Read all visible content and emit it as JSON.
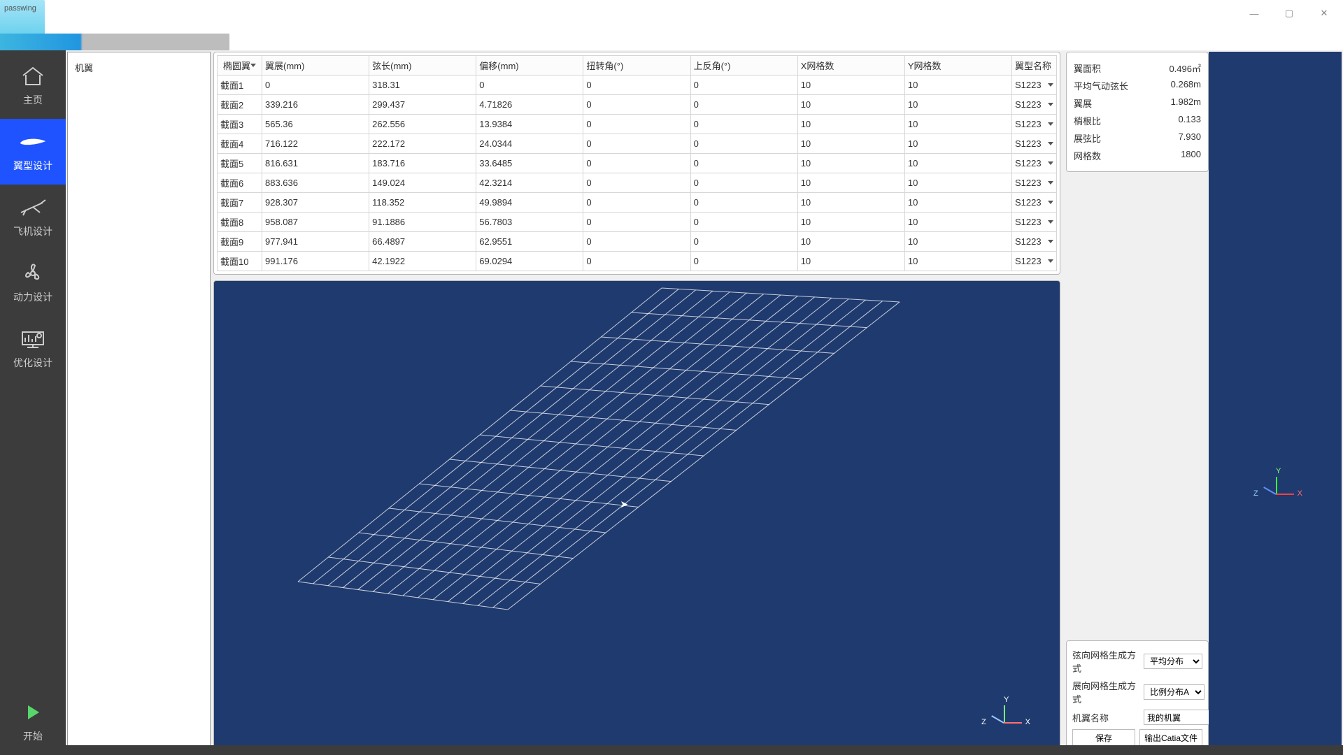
{
  "window": {
    "title": "passwing"
  },
  "nav": {
    "items": [
      {
        "id": "home",
        "label": "主页"
      },
      {
        "id": "wing",
        "label": "翼型设计"
      },
      {
        "id": "plane",
        "label": "飞机设计"
      },
      {
        "id": "power",
        "label": "动力设计"
      },
      {
        "id": "optimize",
        "label": "优化设计"
      }
    ],
    "start_label": "开始",
    "active": "wing"
  },
  "tree": {
    "root": "机翼"
  },
  "table": {
    "shape_selector": "椭圆翼",
    "headers": [
      "翼展(mm)",
      "弦长(mm)",
      "偏移(mm)",
      "扭转角(°)",
      "上反角(°)",
      "X网格数",
      "Y网格数",
      "翼型名称"
    ],
    "rows": [
      {
        "label": "截面1",
        "span": "0",
        "chord": "318.31",
        "offset": "0",
        "twist": "0",
        "dihedral": "0",
        "xg": "10",
        "yg": "10",
        "airfoil": "S1223"
      },
      {
        "label": "截面2",
        "span": "339.216",
        "chord": "299.437",
        "offset": "4.71826",
        "twist": "0",
        "dihedral": "0",
        "xg": "10",
        "yg": "10",
        "airfoil": "S1223"
      },
      {
        "label": "截面3",
        "span": "565.36",
        "chord": "262.556",
        "offset": "13.9384",
        "twist": "0",
        "dihedral": "0",
        "xg": "10",
        "yg": "10",
        "airfoil": "S1223"
      },
      {
        "label": "截面4",
        "span": "716.122",
        "chord": "222.172",
        "offset": "24.0344",
        "twist": "0",
        "dihedral": "0",
        "xg": "10",
        "yg": "10",
        "airfoil": "S1223"
      },
      {
        "label": "截面5",
        "span": "816.631",
        "chord": "183.716",
        "offset": "33.6485",
        "twist": "0",
        "dihedral": "0",
        "xg": "10",
        "yg": "10",
        "airfoil": "S1223"
      },
      {
        "label": "截面6",
        "span": "883.636",
        "chord": "149.024",
        "offset": "42.3214",
        "twist": "0",
        "dihedral": "0",
        "xg": "10",
        "yg": "10",
        "airfoil": "S1223"
      },
      {
        "label": "截面7",
        "span": "928.307",
        "chord": "118.352",
        "offset": "49.9894",
        "twist": "0",
        "dihedral": "0",
        "xg": "10",
        "yg": "10",
        "airfoil": "S1223"
      },
      {
        "label": "截面8",
        "span": "958.087",
        "chord": "91.1886",
        "offset": "56.7803",
        "twist": "0",
        "dihedral": "0",
        "xg": "10",
        "yg": "10",
        "airfoil": "S1223"
      },
      {
        "label": "截面9",
        "span": "977.941",
        "chord": "66.4897",
        "offset": "62.9551",
        "twist": "0",
        "dihedral": "0",
        "xg": "10",
        "yg": "10",
        "airfoil": "S1223"
      },
      {
        "label": "截面10",
        "span": "991.176",
        "chord": "42.1922",
        "offset": "69.0294",
        "twist": "0",
        "dihedral": "0",
        "xg": "10",
        "yg": "10",
        "airfoil": "S1223"
      }
    ]
  },
  "stats": [
    {
      "k": "翼面积",
      "v": "0.496㎡"
    },
    {
      "k": "平均气动弦长",
      "v": "0.268m"
    },
    {
      "k": "翼展",
      "v": "1.982m"
    },
    {
      "k": "梢根比",
      "v": "0.133"
    },
    {
      "k": "展弦比",
      "v": "7.930"
    },
    {
      "k": "网格数",
      "v": "1800"
    }
  ],
  "controls": {
    "chord_method_label": "弦向网格生成方式",
    "chord_method_value": "平均分布",
    "span_method_label": "展向网格生成方式",
    "span_method_value": "比例分布A",
    "wing_name_label": "机翼名称",
    "wing_name_value": "我的机翼",
    "save": "保存",
    "export_catia": "输出Catia文件"
  },
  "axes": {
    "x": "X",
    "y": "Y",
    "z": "Z"
  }
}
